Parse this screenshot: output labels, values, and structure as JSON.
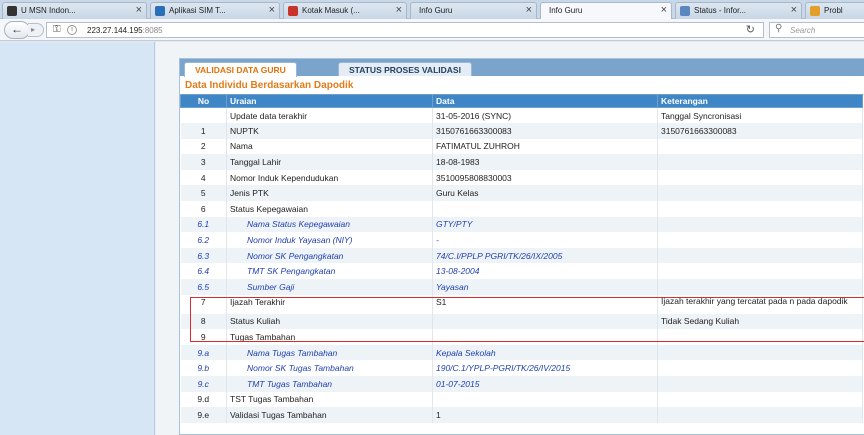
{
  "browser": {
    "tabs": [
      {
        "label": "U MSN Indon...",
        "icon_color": "#333333",
        "active": false
      },
      {
        "label": "Aplikasi SIM T...",
        "icon_color": "#2a6fb5",
        "active": false
      },
      {
        "label": "Kotak Masuk (...",
        "icon_color": "#c9342a",
        "active": false
      },
      {
        "label": "Info Guru",
        "icon_color": "",
        "active": false
      },
      {
        "label": "Info Guru",
        "icon_color": "",
        "active": true
      },
      {
        "label": "Status - Infor...",
        "icon_color": "#5b87c0",
        "active": false
      },
      {
        "label": "Probl",
        "icon_color": "#e2a02a",
        "active": false
      }
    ],
    "url_host": "223.27.144.195",
    "url_port": ":8085",
    "search_placeholder": "Search",
    "icons": {
      "back": "back-arrow-icon",
      "lock": "key-icon",
      "reload": "reload-icon",
      "search": "search-icon"
    }
  },
  "panel": {
    "tabs": [
      "VALIDASI DATA GURU",
      "STATUS PROSES VALIDASI"
    ],
    "title": "Data Individu Berdasarkan Dapodik",
    "columns": [
      "No",
      "Uraian",
      "Data",
      "Keterangan"
    ],
    "rows": [
      {
        "no": "",
        "uraian": "Update data terakhir",
        "data": "31-05-2016 (SYNC)",
        "ket": "Tanggal Syncronisasi",
        "sub": false
      },
      {
        "no": "1",
        "uraian": "NUPTK",
        "data": "3150761663300083",
        "ket": "3150761663300083",
        "sub": false
      },
      {
        "no": "2",
        "uraian": "Nama",
        "data": "FATIMATUL ZUHROH",
        "ket": "",
        "sub": false
      },
      {
        "no": "3",
        "uraian": "Tanggal Lahir",
        "data": "18-08-1983",
        "ket": "",
        "sub": false
      },
      {
        "no": "4",
        "uraian": "Nomor Induk Kependudukan",
        "data": "3510095808830003",
        "ket": "",
        "sub": false
      },
      {
        "no": "5",
        "uraian": "Jenis PTK",
        "data": "Guru Kelas",
        "ket": "",
        "sub": false
      },
      {
        "no": "6",
        "uraian": "Status Kepegawaian",
        "data": "",
        "ket": "",
        "sub": false
      },
      {
        "no": "6.1",
        "uraian": "Nama Status Kepegawaian",
        "data": "GTY/PTY",
        "ket": "",
        "sub": true
      },
      {
        "no": "6.2",
        "uraian": "Nomor Induk Yayasan (NIY)",
        "data": "-",
        "ket": "",
        "sub": true
      },
      {
        "no": "6.3",
        "uraian": "Nomor SK Pengangkatan",
        "data": "74/C.I/PPLP PGRI/TK/26/IX/2005",
        "ket": "",
        "sub": true
      },
      {
        "no": "6.4",
        "uraian": "TMT SK Pengangkatan",
        "data": "13-08-2004",
        "ket": "",
        "sub": true
      },
      {
        "no": "6.5",
        "uraian": "Sumber Gaji",
        "data": "Yayasan",
        "ket": "",
        "sub": true
      },
      {
        "no": "7",
        "uraian": "Ijazah Terakhir",
        "data": "S1",
        "ket": "Ijazah terakhir yang tercatat pada n pada dapodik",
        "sub": false,
        "tall": true
      },
      {
        "no": "8",
        "uraian": "Status Kuliah",
        "data": "",
        "ket": "Tidak Sedang Kuliah",
        "sub": false
      },
      {
        "no": "9",
        "uraian": "Tugas Tambahan",
        "data": "",
        "ket": "",
        "sub": false
      },
      {
        "no": "9.a",
        "uraian": "Nama Tugas Tambahan",
        "data": "Kepala Sekolah",
        "ket": "",
        "sub": true
      },
      {
        "no": "9.b",
        "uraian": "Nomor SK Tugas Tambahan",
        "data": "190/C.1/YPLP-PGRI/TK/26/IV/2015",
        "ket": "",
        "sub": true
      },
      {
        "no": "9.c",
        "uraian": "TMT Tugas Tambahan",
        "data": "01-07-2015",
        "ket": "",
        "sub": true
      },
      {
        "no": "9.d",
        "uraian": "TST Tugas Tambahan",
        "data": "",
        "ket": "",
        "sub": false
      },
      {
        "no": "9.e",
        "uraian": "Validasi Tugas Tambahan",
        "data": "1",
        "ket": "",
        "sub": false
      }
    ]
  },
  "colors": {
    "accent": "#e07c1a",
    "header": "#3f86c6",
    "highlight": "#d62c2c",
    "subtext": "#1f3fb0"
  }
}
